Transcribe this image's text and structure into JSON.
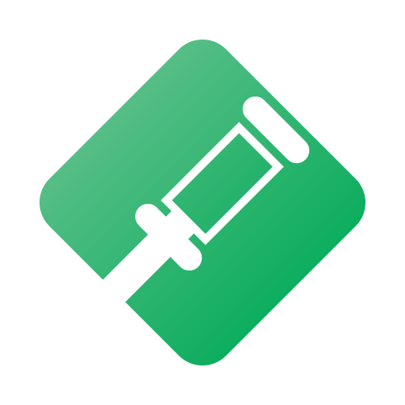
{
  "logo": {
    "icon": "gavel-icon",
    "colors": {
      "gradient_start": "#63C18D",
      "gradient_end": "#00AA57",
      "mark": "#FFFFFF"
    }
  }
}
